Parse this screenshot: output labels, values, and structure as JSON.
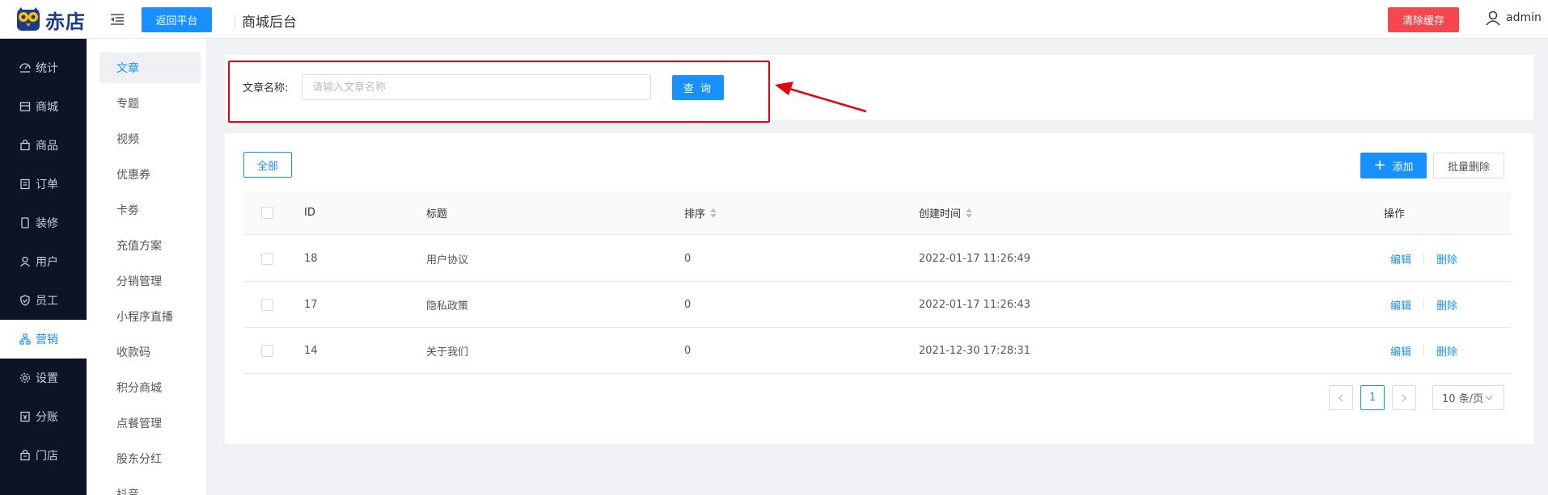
{
  "header": {
    "logo_text": "赤店",
    "back_button": "返回平台",
    "title": "商城后台",
    "clear_cache_button": "清除缓存",
    "user_name": "admin"
  },
  "sidebar": {
    "items": [
      {
        "label": "统计",
        "icon": "dashboard-icon"
      },
      {
        "label": "商城",
        "icon": "store-icon"
      },
      {
        "label": "商品",
        "icon": "shopping-bag-icon"
      },
      {
        "label": "订单",
        "icon": "order-list-icon"
      },
      {
        "label": "装修",
        "icon": "mobile-icon"
      },
      {
        "label": "用户",
        "icon": "user-icon"
      },
      {
        "label": "员工",
        "icon": "shield-check-icon"
      },
      {
        "label": "营销",
        "icon": "network-icon",
        "active": true
      },
      {
        "label": "设置",
        "icon": "gear-icon"
      },
      {
        "label": "分账",
        "icon": "ledger-icon"
      },
      {
        "label": "门店",
        "icon": "shop-icon"
      }
    ]
  },
  "submenu": {
    "items": [
      "文章",
      "专题",
      "视频",
      "优惠券",
      "卡劵",
      "充值方案",
      "分销管理",
      "小程序直播",
      "收款码",
      "积分商城",
      "点餐管理",
      "股东分红",
      "抖音"
    ],
    "active_index": 0
  },
  "search": {
    "label": "文章名称:",
    "placeholder": "请输入文章名称",
    "value": "",
    "button": "查 询"
  },
  "toolbar": {
    "all_button": "全部",
    "add_button": "添加",
    "batch_delete_button": "批量删除"
  },
  "table": {
    "headers": {
      "id": "ID",
      "title": "标题",
      "sort": "排序",
      "created": "创建时间",
      "actions": "操作"
    },
    "rows": [
      {
        "id": "18",
        "title": "用户协议",
        "sort": "0",
        "created": "2022-01-17 11:26:49",
        "edit": "编辑",
        "delete": "删除"
      },
      {
        "id": "17",
        "title": "隐私政策",
        "sort": "0",
        "created": "2022-01-17 11:26:43",
        "edit": "编辑",
        "delete": "删除"
      },
      {
        "id": "14",
        "title": "关于我们",
        "sort": "0",
        "created": "2021-12-30 17:28:31",
        "edit": "编辑",
        "delete": "删除"
      }
    ]
  },
  "pagination": {
    "current_page": "1",
    "page_size": "10 条/页"
  },
  "colors": {
    "primary": "#1890ff",
    "danger": "#f5484e",
    "sidebar_bg": "#0b1526",
    "highlight": "#e60012"
  }
}
